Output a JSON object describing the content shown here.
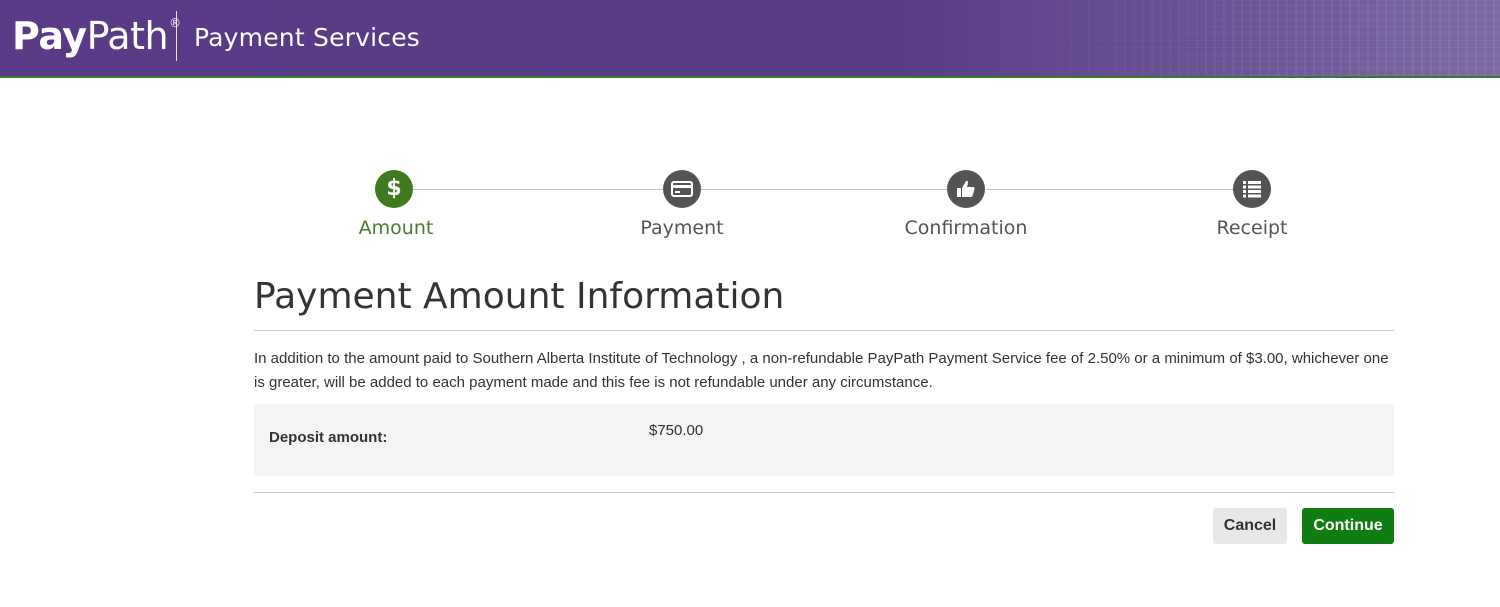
{
  "header": {
    "logo_pay": "Pay",
    "logo_path": "Path",
    "logo_reg": "®",
    "title": "Payment Services"
  },
  "stepper": {
    "steps": [
      {
        "label": "Amount",
        "icon": "dollar-icon",
        "active": true
      },
      {
        "label": "Payment",
        "icon": "credit-card-icon",
        "active": false
      },
      {
        "label": "Confirmation",
        "icon": "thumbs-up-icon",
        "active": false
      },
      {
        "label": "Receipt",
        "icon": "list-icon",
        "active": false
      }
    ],
    "dollar_glyph": "$"
  },
  "main": {
    "title": "Payment Amount Information",
    "info": "In addition to the amount paid to Southern Alberta Institute of Technology , a non-refundable PayPath Payment Service fee of 2.50% or a minimum of $3.00, whichever one is greater, will be added to each payment made and this fee is not refundable under any circumstance.",
    "deposit_label": "Deposit amount:",
    "deposit_value": "$750.00"
  },
  "actions": {
    "cancel_label": "Cancel",
    "continue_label": "Continue"
  },
  "colors": {
    "header_purple": "#5a3a86",
    "active_green": "#3f7a1e",
    "continue_green": "#0f7d12",
    "inactive_step": "#545454"
  }
}
